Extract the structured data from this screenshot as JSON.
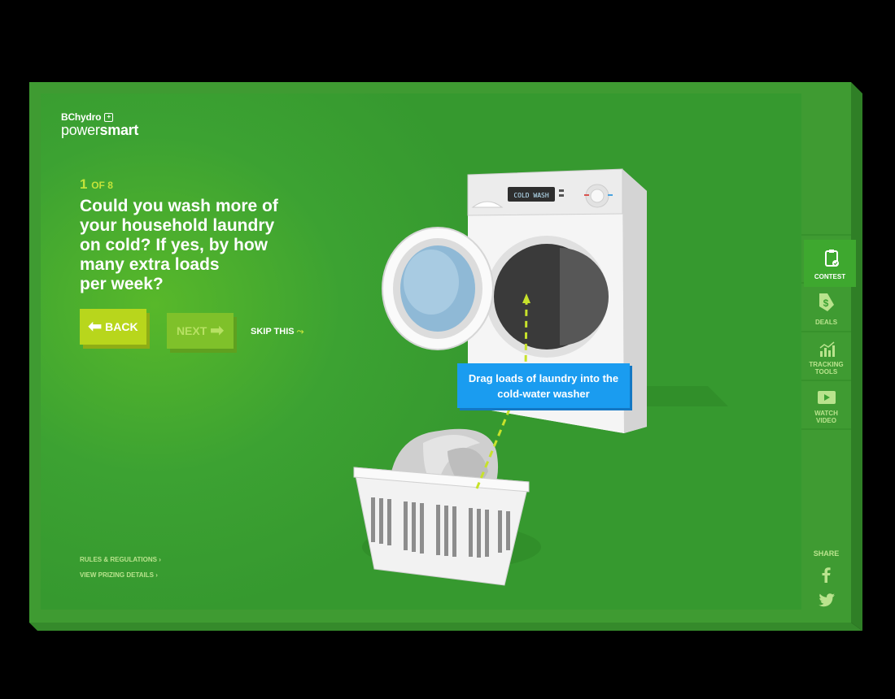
{
  "logo": {
    "brand": "BChydro",
    "product_regular": "power",
    "product_bold": "smart"
  },
  "quiz": {
    "counter_num": "1",
    "counter_of": "OF 8",
    "question": "Could you wash more of\nyour household laundry\non cold? If yes, by how\nmany extra loads\nper week?",
    "back_label": "BACK",
    "next_label": "NEXT",
    "skip_label": "SKIP THIS"
  },
  "illustration": {
    "washer_display": "COLD WASH",
    "tooltip": "Drag loads of laundry into the cold-water washer"
  },
  "footer": {
    "rules": "RULES & REGULATIONS ›",
    "prizing": "VIEW PRIZING DETAILS ›"
  },
  "sidenav": [
    {
      "label_1": "CONTEST",
      "label_2": "",
      "icon": "clipboard-icon"
    },
    {
      "label_1": "DEALS",
      "label_2": "",
      "icon": "price-tag-icon"
    },
    {
      "label_1": "TRACKING",
      "label_2": "TOOLS",
      "icon": "bar-chart-icon"
    },
    {
      "label_1": "WATCH",
      "label_2": "VIDEO",
      "icon": "play-icon"
    }
  ],
  "share": {
    "label": "SHARE",
    "networks": [
      "facebook-icon",
      "twitter-icon"
    ]
  },
  "colors": {
    "green": "#3ca232",
    "lime": "#b8d61c",
    "blue": "#1a9cf0"
  }
}
